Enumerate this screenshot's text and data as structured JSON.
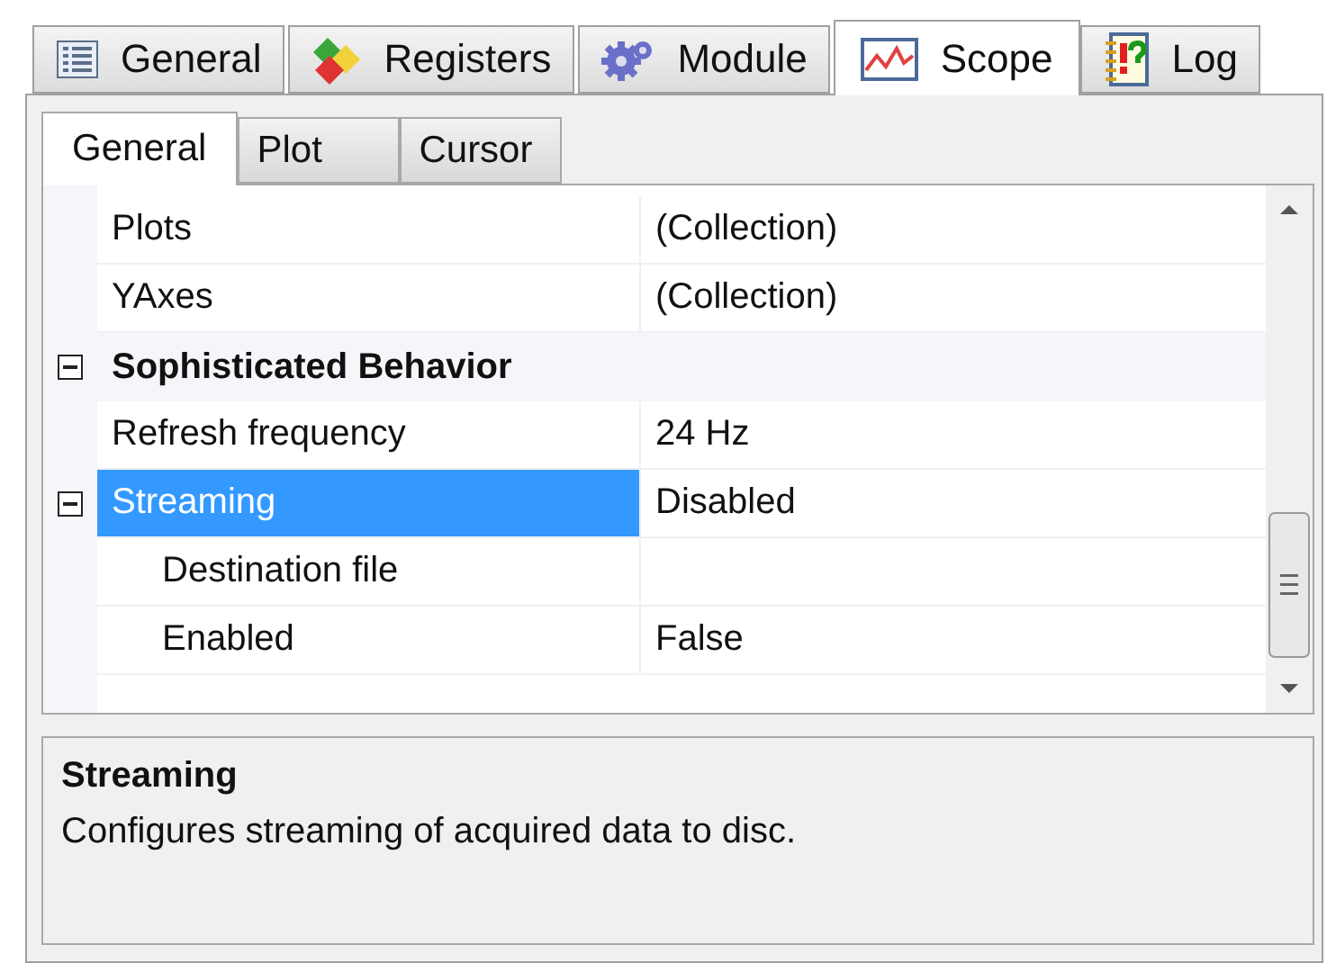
{
  "main_tabs": [
    {
      "label": "General",
      "selected": false
    },
    {
      "label": "Registers",
      "selected": false
    },
    {
      "label": "Module",
      "selected": false
    },
    {
      "label": "Scope",
      "selected": true
    },
    {
      "label": "Log",
      "selected": false
    }
  ],
  "sub_tabs": [
    {
      "label": "General",
      "selected": true
    },
    {
      "label": "Plot",
      "selected": false
    },
    {
      "label": "Cursor",
      "selected": false
    }
  ],
  "property_grid": {
    "rows": [
      {
        "kind": "property",
        "name": "Plots",
        "value": "(Collection)",
        "selected": false
      },
      {
        "kind": "property",
        "name": "YAxes",
        "value": "(Collection)",
        "selected": false
      },
      {
        "kind": "category",
        "name": "Sophisticated Behavior",
        "expanded": true,
        "children": [
          {
            "kind": "property",
            "name": "Refresh frequency",
            "value": "24 Hz",
            "selected": false
          },
          {
            "kind": "property",
            "name": "Streaming",
            "value": "Disabled",
            "selected": true,
            "expanded": true,
            "children": [
              {
                "kind": "property",
                "name": "Destination file",
                "selected": false
              },
              {
                "kind": "property",
                "name": "Enabled",
                "value": "False",
                "selected": false
              }
            ]
          }
        ]
      }
    ]
  },
  "description": {
    "title": "Streaming",
    "text": "Configures streaming of acquired data to disc."
  }
}
